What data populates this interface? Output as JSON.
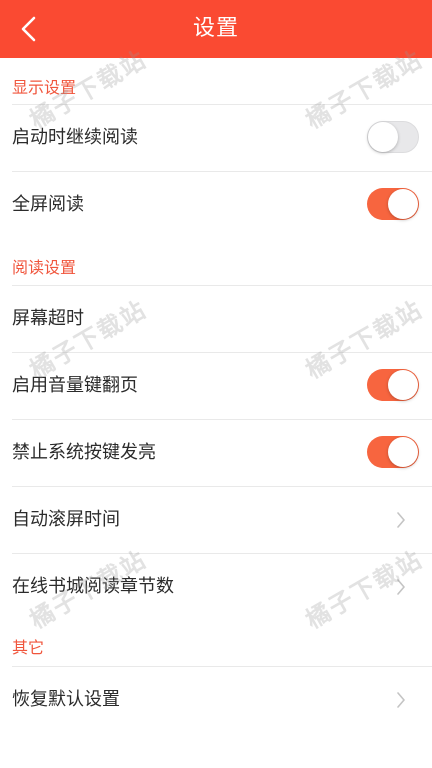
{
  "header": {
    "title": "设置",
    "background_color": "#fa4a32",
    "back_icon": "chevron-left-icon"
  },
  "sections": {
    "display": {
      "title": "显示设置",
      "continue_reading": {
        "label": "启动时继续阅读",
        "toggle": "off"
      },
      "fullscreen": {
        "label": "全屏阅读",
        "toggle": "on"
      }
    },
    "reading": {
      "title": "阅读设置",
      "screen_timeout": {
        "label": "屏幕超时"
      },
      "volume_key_paging": {
        "label": "启用音量键翻页",
        "toggle": "on"
      },
      "disable_key_backlight": {
        "label": "禁止系统按键发亮",
        "toggle": "on"
      },
      "auto_scroll_time": {
        "label": "自动滚屏时间",
        "icon": "chevron-right-icon"
      },
      "online_chapters": {
        "label": "在线书城阅读章节数",
        "icon": "chevron-right-icon"
      }
    },
    "other": {
      "title": "其它",
      "restore_defaults": {
        "label": "恢复默认设置",
        "icon": "chevron-right-icon"
      }
    }
  },
  "watermark": {
    "text": "橘子下载站"
  },
  "colors": {
    "accent": "#f0553c",
    "toggle_on": "#f7653f",
    "toggle_off": "#e8e8ea",
    "divider": "#e9e9e9",
    "text": "#2b2b2b"
  }
}
